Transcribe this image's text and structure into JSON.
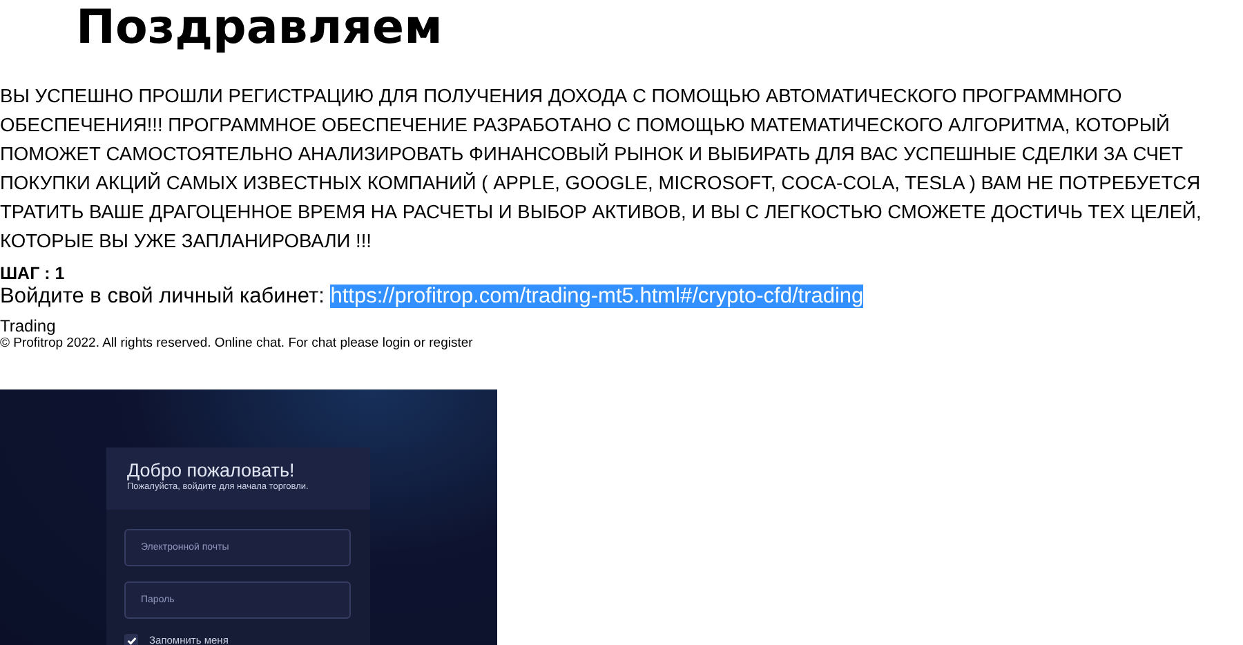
{
  "heading": "Поздравляем",
  "message": "ВЫ УСПЕШНО ПРОШЛИ РЕГИСТРАЦИЮ ДЛЯ ПОЛУЧЕНИЯ ДОХОДА С ПОМОЩЬЮ АВТОМАТИЧЕСКОГО ПРОГРАММНОГО ОБЕСПЕЧЕНИЯ!!! ПРОГРАММНОЕ ОБЕСПЕЧЕНИЕ РАЗРАБОТАНО С ПОМОЩЬЮ МАТЕМАТИЧЕСКОГО АЛГОРИТМА, КОТОРЫЙ ПОМОЖЕТ САМОСТОЯТЕЛЬНО АНАЛИЗИРОВАТЬ ФИНАНСОВЫЙ РЫНОК И ВЫБИРАТЬ ДЛЯ ВАС УСПЕШНЫЕ СДЕЛКИ ЗА СЧЕТ ПОКУПКИ АКЦИЙ САМЫХ ИЗВЕСТНЫХ КОМПАНИЙ ( APPLE, GOOGLE, MICROSOFT, COCA-COLA, TESLA ) ВАМ НЕ ПОТРЕБУЕТСЯ ТРАТИТЬ ВАШЕ ДРАГОЦЕННОЕ ВРЕМЯ НА РАСЧЕТЫ И ВЫБОР АКТИВОВ, И ВЫ С ЛЕГКОСТЬЮ СМОЖЕТЕ ДОСТИЧЬ ТЕХ ЦЕЛЕЙ, КОТОРЫЕ ВЫ УЖЕ ЗАПЛАНИРОВАЛИ !!!",
  "step": {
    "label": "ШАГ : 1",
    "instruction": "Войдите в свой личный кабинет:",
    "link": {
      "text": "https://profitrop.com/trading-mt5.html#/crypto-cfd/trading",
      "selected": true
    }
  },
  "footer": {
    "title": "Trading",
    "copyright": "© Profitrop 2022. All rights reserved. Online chat. For chat please login or register"
  },
  "login_screenshot": {
    "title": "Добро пожаловать!",
    "subtitle": "Пожалуйста, войдите для начала торговли.",
    "fields": [
      {
        "placeholder": "Электронной почты"
      },
      {
        "placeholder": "Пароль"
      }
    ],
    "remember": {
      "label": "Запомнить меня",
      "checked": true
    }
  }
}
